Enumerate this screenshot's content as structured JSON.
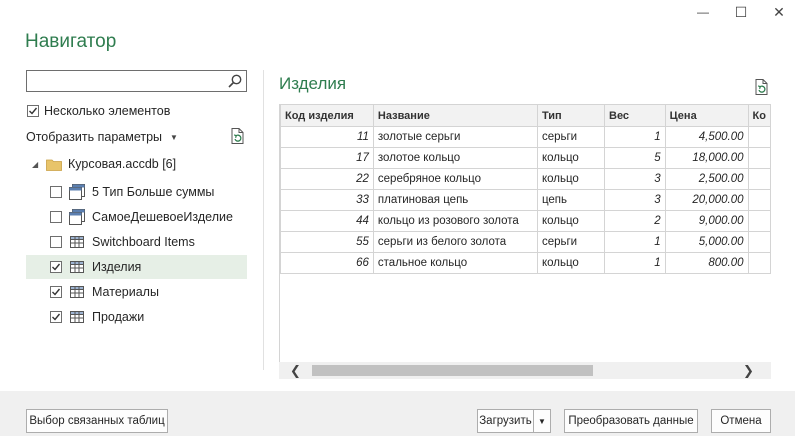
{
  "window": {
    "minimize_glyph": "—",
    "maximize_glyph": "☐",
    "close_glyph": "✕"
  },
  "title": "Навигатор",
  "search": {
    "value": "",
    "placeholder": ""
  },
  "multi_select": {
    "label": "Несколько элементов",
    "checked": true
  },
  "display_options": {
    "label": "Отобразить параметры"
  },
  "tree": {
    "root": "Курсовая.accdb [6]",
    "items": [
      {
        "label": "5 Тип Больше суммы",
        "checked": false,
        "icon": "query-icon"
      },
      {
        "label": "СамоеДешевоеИзделие",
        "checked": false,
        "icon": "query-icon"
      },
      {
        "label": "Switchboard Items",
        "checked": false,
        "icon": "table-icon"
      },
      {
        "label": "Изделия",
        "checked": true,
        "icon": "table-icon",
        "selected": true
      },
      {
        "label": "Материалы",
        "checked": true,
        "icon": "table-icon"
      },
      {
        "label": "Продажи",
        "checked": true,
        "icon": "table-icon"
      }
    ]
  },
  "preview": {
    "title": "Изделия",
    "columns": [
      "Код изделия",
      "Название",
      "Тип",
      "Вес",
      "Цена",
      "Ко"
    ],
    "rows": [
      [
        "11",
        "золотые серьги",
        "серьги",
        "1",
        "4,500.00"
      ],
      [
        "17",
        "золотое кольцо",
        "кольцо",
        "5",
        "18,000.00"
      ],
      [
        "22",
        "серебряное кольцо",
        "кольцо",
        "3",
        "2,500.00"
      ],
      [
        "33",
        "платиновая цепь",
        "цепь",
        "3",
        "20,000.00"
      ],
      [
        "44",
        "кольцо из розового золота",
        "кольцо",
        "2",
        "9,000.00"
      ],
      [
        "55",
        "серьги из белого золота",
        "серьги",
        "1",
        "5,000.00"
      ],
      [
        "66",
        "стальное кольцо",
        "кольцо",
        "1",
        "800.00"
      ]
    ]
  },
  "scroll": {
    "left_glyph": "❮",
    "right_glyph": "❯"
  },
  "footer": {
    "related_label": "Выбор связанных таблиц",
    "load_label": "Загрузить",
    "load_drop_glyph": "▼",
    "transform_label": "Преобразовать данные",
    "cancel_label": "Отмена"
  },
  "colors": {
    "accent": "#2f7d4f",
    "selected_row": "#e6efe6"
  }
}
